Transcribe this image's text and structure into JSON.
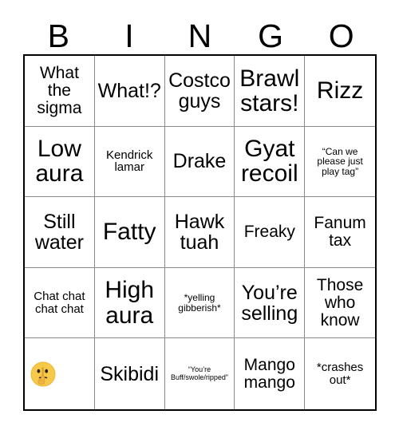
{
  "card": {
    "title": "BINGO",
    "header_letters": [
      "B",
      "I",
      "N",
      "G",
      "O"
    ],
    "colors": {
      "background": "#ffffff",
      "text": "#000000",
      "outer_border": "#000000",
      "inner_grid_line": "#8a8a8a",
      "emoji_yellow": "#f7c94b"
    },
    "rows": [
      {
        "cells": [
          {
            "text": "What the sigma",
            "size": "md"
          },
          {
            "text": "What!?",
            "size": "lg"
          },
          {
            "text": "Costco guys",
            "size": "lg"
          },
          {
            "text": "Brawl stars!",
            "size": "xl"
          },
          {
            "text": "Rizz",
            "size": "xl"
          }
        ]
      },
      {
        "cells": [
          {
            "text": "Low aura",
            "size": "xl"
          },
          {
            "text": "Kendrick lamar",
            "size": "sm"
          },
          {
            "text": "Drake",
            "size": "lg"
          },
          {
            "text": "Gyat recoil",
            "size": "xl"
          },
          {
            "text": "“Can we please just play tag”",
            "size": "xs"
          }
        ]
      },
      {
        "cells": [
          {
            "text": "Still water",
            "size": "lg"
          },
          {
            "text": "Fatty",
            "size": "xl"
          },
          {
            "text": "Hawk tuah",
            "size": "lg"
          },
          {
            "text": "Freaky",
            "size": "md"
          },
          {
            "text": "Fanum tax",
            "size": "md"
          }
        ]
      },
      {
        "cells": [
          {
            "text": "Chat chat chat chat",
            "size": "sm"
          },
          {
            "text": "High aura",
            "size": "xl"
          },
          {
            "text": "*yelling gibberish*",
            "size": "xs"
          },
          {
            "text": "You’re selling",
            "size": "lg"
          },
          {
            "text": "Those who know",
            "size": "md"
          }
        ]
      },
      {
        "cells": [
          {
            "text": "",
            "size": "md",
            "icon": "shushing-face-emoji"
          },
          {
            "text": "Skibidi",
            "size": "lg"
          },
          {
            "text": "“You’re Buff/swole/ripped”",
            "size": "xxs"
          },
          {
            "text": "Mango mango",
            "size": "md"
          },
          {
            "text": "*crashes out*",
            "size": "sm"
          }
        ]
      }
    ]
  }
}
